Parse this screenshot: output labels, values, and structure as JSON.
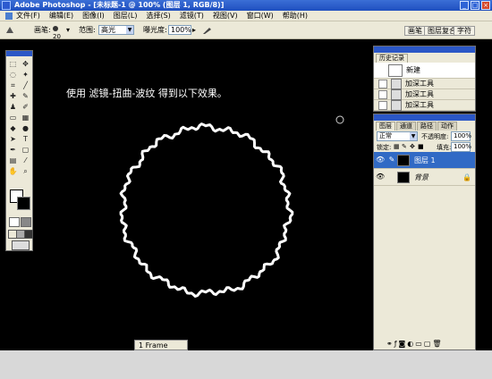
{
  "window": {
    "title": "Adobe Photoshop - [未标题-1 @ 100% (图层 1, RGB/8)]",
    "controls": [
      "_",
      "□",
      "×"
    ]
  },
  "menu": {
    "items": [
      "文件(F)",
      "编辑(E)",
      "图像(I)",
      "图层(L)",
      "选择(S)",
      "滤镜(T)",
      "视图(V)",
      "窗口(W)",
      "帮助(H)"
    ]
  },
  "options": {
    "brush_label": "画笔:",
    "brush_size": "20",
    "range_label": "范围:",
    "range_value": "高光",
    "exposure_label": "曝光度:",
    "exposure_value": "100%",
    "well_tabs": [
      "画笔",
      "图层复合",
      "字符"
    ]
  },
  "canvas": {
    "caption": "使用 滤镜-扭曲-波纹 得到以下效果。",
    "ring_color": "#ffffff"
  },
  "history_panel": {
    "tab": "历史记录",
    "snapshot_label": "新建",
    "items": [
      "加深工具",
      "加深工具",
      "加深工具"
    ]
  },
  "layers_panel": {
    "tabs": [
      "图层",
      "通道",
      "路径",
      "动作"
    ],
    "blend_mode": "正常",
    "opacity_label": "不透明度:",
    "opacity_value": "100%",
    "lock_label": "锁定:",
    "fill_label": "填充:",
    "fill_value": "100%",
    "layers": [
      {
        "name": "图层 1",
        "selected": true
      },
      {
        "name": "背景",
        "selected": false
      }
    ]
  },
  "bottom": {
    "center_text": "1 Frame"
  }
}
